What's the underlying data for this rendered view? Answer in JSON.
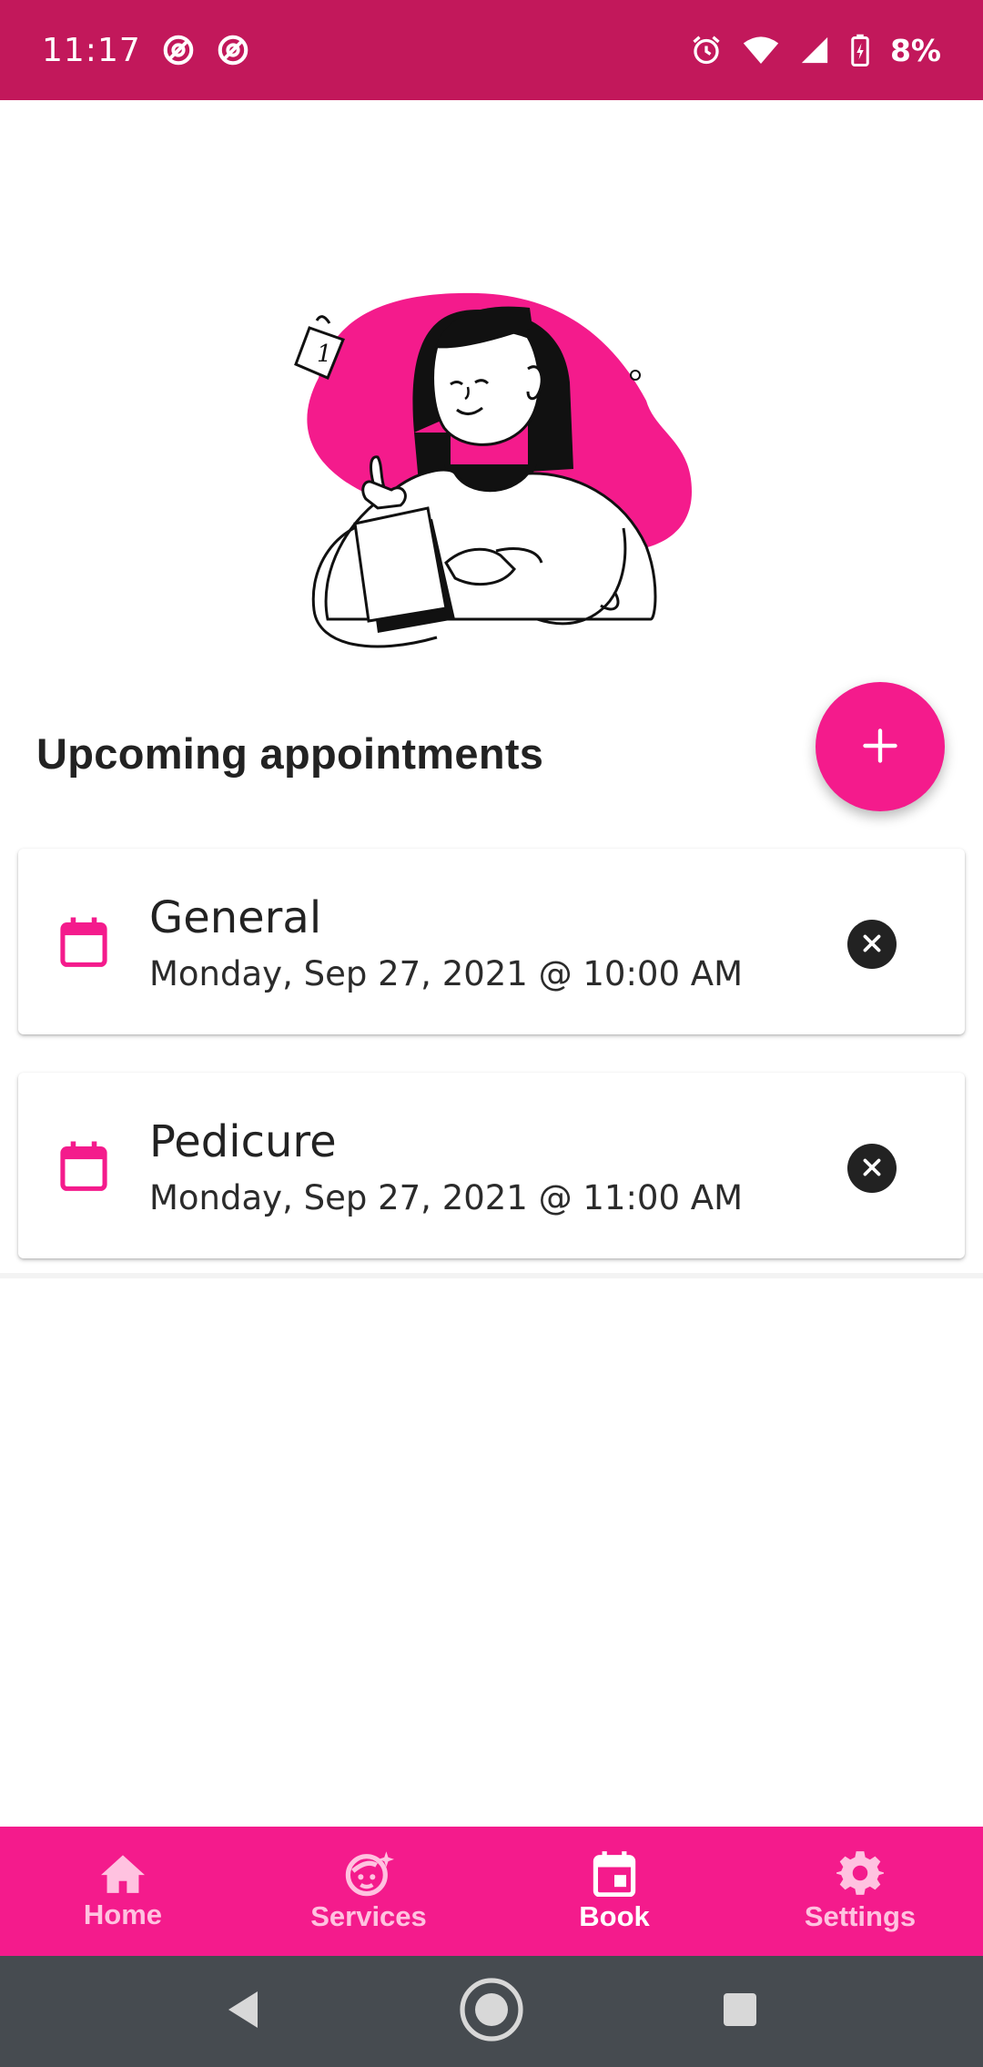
{
  "status_bar": {
    "time": "11:17",
    "battery": "8%",
    "icons": [
      "at-sign-icon",
      "at-sign-icon",
      "alarm-icon",
      "wifi-icon",
      "signal-icon",
      "battery-charging-icon"
    ]
  },
  "colors": {
    "status_bar": "#c2185b",
    "accent": "#f41b8c",
    "nav_inactive": "#ffc2e0",
    "system_nav": "#464b50",
    "text_primary": "#222222"
  },
  "section": {
    "title": "Upcoming appointments"
  },
  "fab": {
    "icon": "plus-icon"
  },
  "appointments": [
    {
      "title": "General",
      "datetime": "Monday, Sep 27, 2021 @ 10:00 AM",
      "icon": "calendar-icon",
      "action_icon": "close-circle-icon"
    },
    {
      "title": "Pedicure",
      "datetime": "Monday, Sep 27, 2021 @ 11:00 AM",
      "icon": "calendar-icon",
      "action_icon": "close-circle-icon"
    }
  ],
  "bottom_nav": {
    "items": [
      {
        "label": "Home",
        "icon": "home-icon",
        "active": false
      },
      {
        "label": "Services",
        "icon": "face-sparkle-icon",
        "active": false
      },
      {
        "label": "Book",
        "icon": "calendar-icon",
        "active": true
      },
      {
        "label": "Settings",
        "icon": "gear-icon",
        "active": false
      }
    ]
  },
  "system_nav": {
    "icons": [
      "back-icon",
      "home-circle-icon",
      "recents-icon"
    ]
  }
}
